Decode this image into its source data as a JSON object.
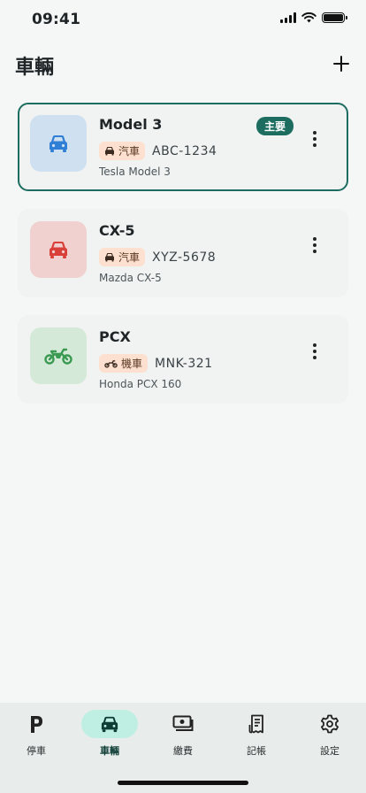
{
  "status_bar": {
    "time": "09:41"
  },
  "header": {
    "title": "車輛"
  },
  "vehicles": [
    {
      "name": "Model 3",
      "badge": "主要",
      "type": "汽車",
      "type_icon": "car-icon",
      "plate": "ABC-1234",
      "model": "Tesla Model 3",
      "icon_color": "#2f7fd6",
      "icon_bg": "#cfe0f1"
    },
    {
      "name": "CX-5",
      "type": "汽車",
      "type_icon": "car-icon",
      "plate": "XYZ-5678",
      "model": "Mazda CX-5",
      "icon_color": "#d9403a",
      "icon_bg": "#f1d1d0"
    },
    {
      "name": "PCX",
      "type": "機車",
      "type_icon": "motorcycle-icon",
      "plate": "MNK-321",
      "model": "Honda PCX 160",
      "icon_color": "#3a9a52",
      "icon_bg": "#d4e9d8"
    }
  ],
  "tabs": [
    {
      "label": "停車",
      "icon": "parking-icon"
    },
    {
      "label": "車輛",
      "icon": "car-icon",
      "active": true
    },
    {
      "label": "繳費",
      "icon": "payment-icon"
    },
    {
      "label": "記帳",
      "icon": "receipt-icon"
    },
    {
      "label": "設定",
      "icon": "gear-icon"
    }
  ],
  "colors": {
    "accent": "#1d6c60",
    "active_tab_bg": "#bfeee3",
    "type_badge_bg": "#fde0cf"
  }
}
